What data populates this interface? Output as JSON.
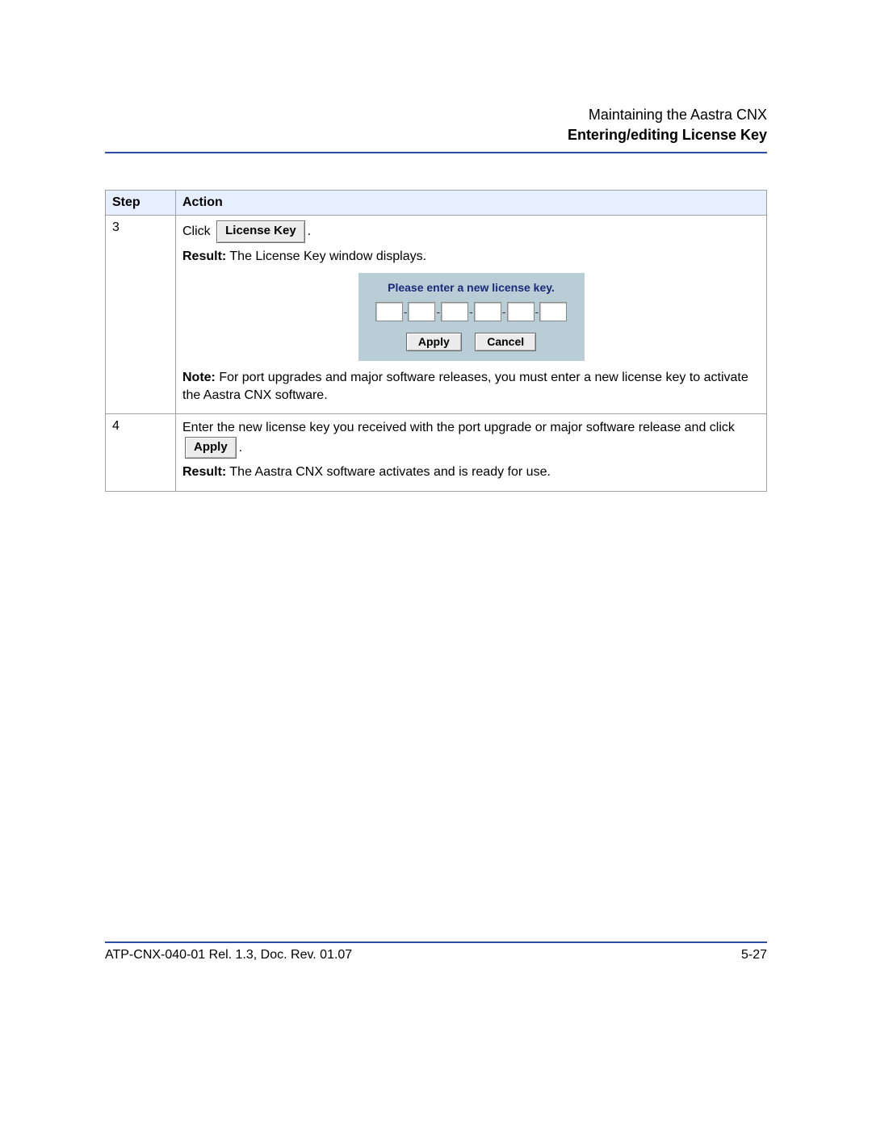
{
  "header": {
    "line1": "Maintaining the Aastra CNX",
    "line2": "Entering/editing License Key"
  },
  "table": {
    "headers": {
      "step": "Step",
      "action": "Action"
    },
    "rows": [
      {
        "step": "3",
        "click_word": "Click",
        "license_key_btn": "License Key",
        "period1": ".",
        "result_label": "Result:",
        "result_text": " The License Key window displays.",
        "dialog": {
          "title": "Please enter a new license key.",
          "apply": "Apply",
          "cancel": "Cancel"
        },
        "note_label": "Note:",
        "note_text": " For port upgrades and major software releases, you must enter a new license key to activate the Aastra CNX software."
      },
      {
        "step": "4",
        "line1": "Enter the new license key you received with the port upgrade or major software release and click",
        "apply_btn": "Apply",
        "period2": ".",
        "result_label": "Result:",
        "result_text": " The Aastra CNX software activates and is ready for use."
      }
    ]
  },
  "footer": {
    "left": "ATP-CNX-040-01 Rel. 1.3, Doc. Rev. 01.07",
    "right": "5-27"
  }
}
